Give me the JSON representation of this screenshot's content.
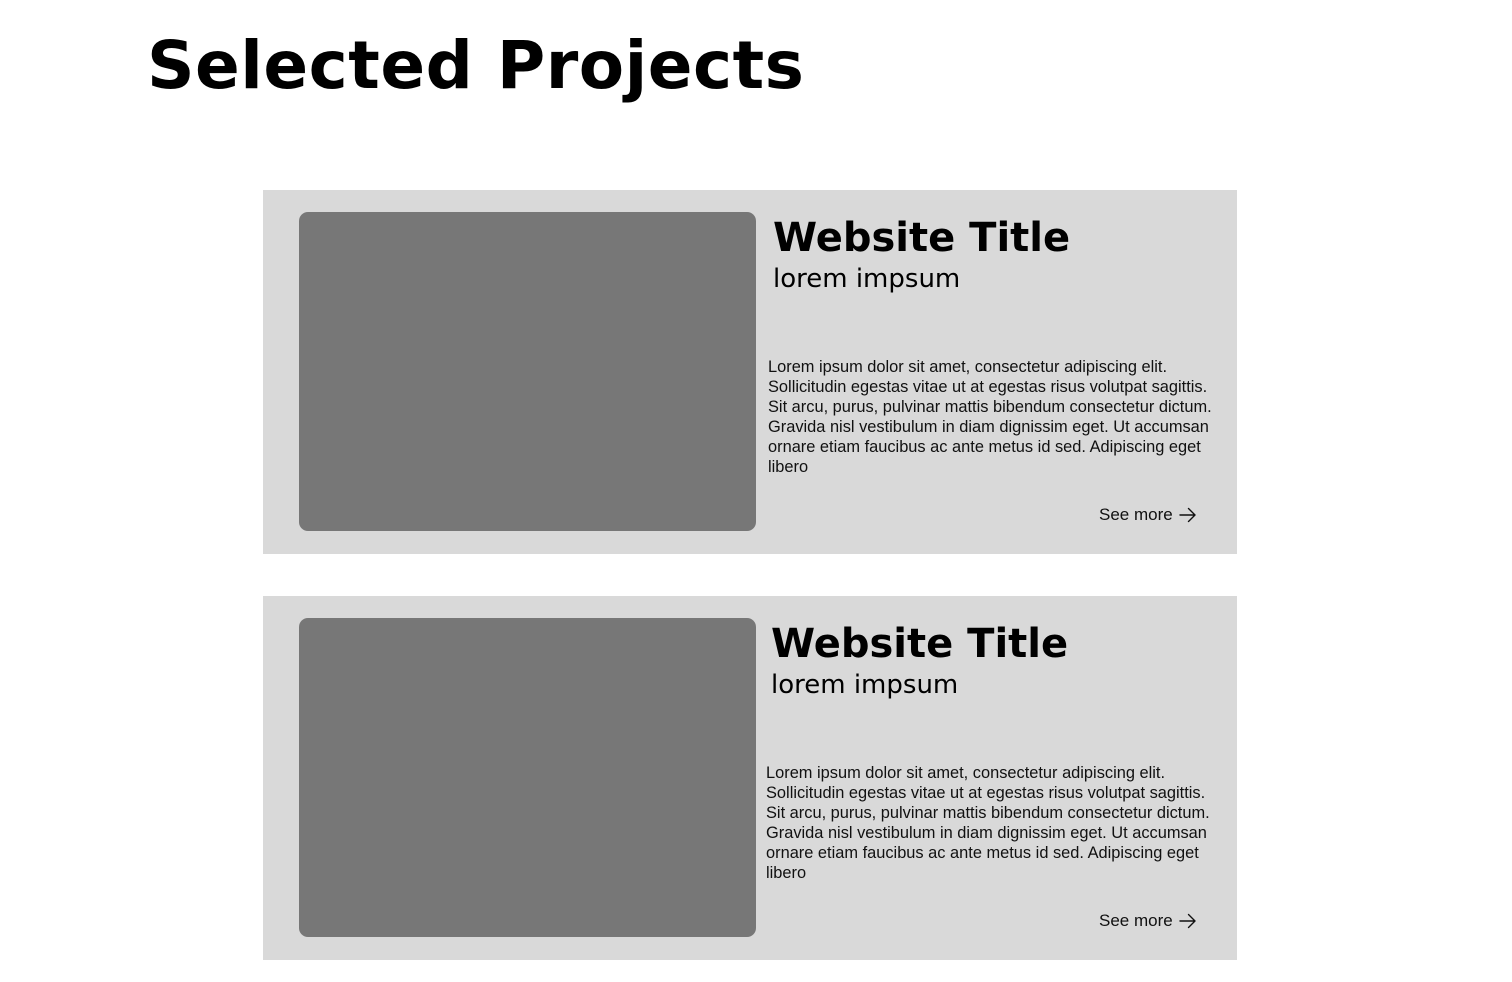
{
  "page": {
    "title": "Selected Projects"
  },
  "projects": [
    {
      "title": "Website Title",
      "subtitle": "lorem impsum",
      "description": "Lorem ipsum dolor sit amet, consectetur adipiscing elit. Sollicitudin egestas vitae ut at egestas risus volutpat sagittis. Sit arcu, purus, pulvinar mattis bibendum consectetur dictum. Gravida nisl vestibulum in diam dignissim eget. Ut accumsan ornare etiam faucibus ac ante metus id sed. Adipiscing eget libero",
      "link_label": "See more",
      "link_icon": "arrow-right-icon"
    },
    {
      "title": "Website Title",
      "subtitle": "lorem impsum",
      "description": "Lorem ipsum dolor sit amet, consectetur adipiscing elit. Sollicitudin egestas vitae ut at egestas risus volutpat sagittis. Sit arcu, purus, pulvinar mattis bibendum consectetur dictum. Gravida nisl vestibulum in diam dignissim eget. Ut accumsan ornare etiam faucibus ac ante metus id sed. Adipiscing eget libero",
      "link_label": "See more",
      "link_icon": "arrow-right-icon"
    }
  ],
  "colors": {
    "background": "#ffffff",
    "card_background": "#d9d9d9",
    "image_placeholder": "#777777",
    "text": "#000000"
  }
}
